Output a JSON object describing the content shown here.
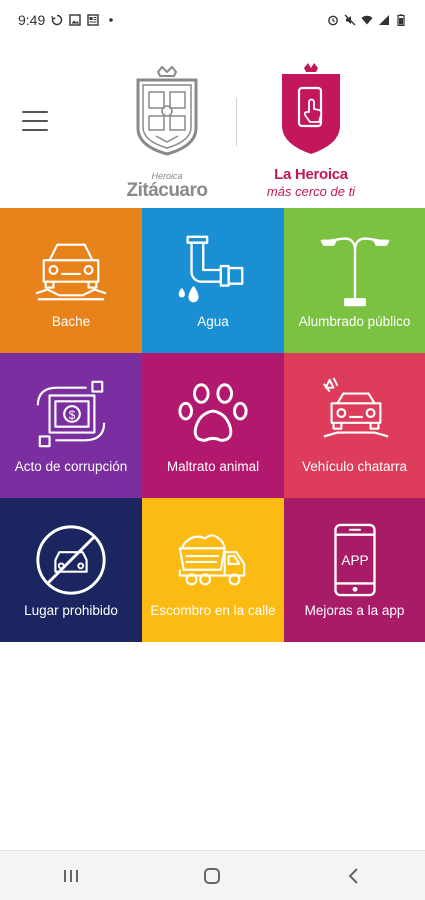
{
  "status_bar": {
    "time": "9:49",
    "left_icons": [
      "sync-icon",
      "image-icon",
      "news-icon",
      "dot-icon"
    ],
    "right_icons": [
      "alarm-icon",
      "mute-icon",
      "wifi-icon",
      "signal-icon",
      "battery-icon"
    ]
  },
  "header": {
    "city_logo": {
      "small_text": "Heroica",
      "name": "Zitácuaro",
      "color": "#8a8a8a"
    },
    "app_logo": {
      "title": "La Heroica",
      "tagline": "más cerco de ti",
      "color": "#c2185b"
    }
  },
  "tiles": [
    {
      "label": "Bache",
      "icon": "car-pothole-icon",
      "color": "#e8821a"
    },
    {
      "label": "Agua",
      "icon": "pipe-icon",
      "color": "#1a8fd4"
    },
    {
      "label": "Alumbrado público",
      "icon": "streetlight-icon",
      "color": "#7cc242"
    },
    {
      "label": "Acto de corrupción",
      "icon": "bribe-icon",
      "color": "#7b2ea0"
    },
    {
      "label": "Maltrato animal",
      "icon": "paw-icon",
      "color": "#b2186e"
    },
    {
      "label": "Vehículo chatarra",
      "icon": "wrecked-car-icon",
      "color": "#dd3d5a"
    },
    {
      "label": "Lugar prohibido",
      "icon": "no-parking-icon",
      "color": "#1b2560"
    },
    {
      "label": "Escombro en la calle",
      "icon": "dump-truck-icon",
      "color": "#fbbb13"
    },
    {
      "label": "Mejoras a la app",
      "icon": "phone-app-icon",
      "color": "#a81c67",
      "icon_text": "APP"
    }
  ],
  "nav_bar": {
    "buttons": [
      "recents-icon",
      "home-icon",
      "back-icon"
    ]
  }
}
